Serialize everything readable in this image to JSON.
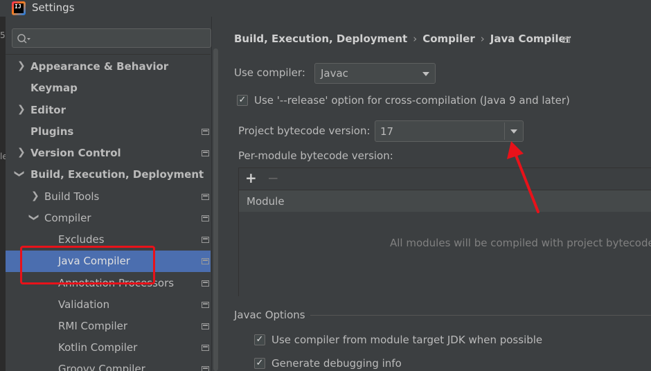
{
  "window": {
    "title": "Settings"
  },
  "gutter": {
    "frag1": "5",
    "frag2": "le"
  },
  "sidebar": {
    "search_placeholder": "",
    "items": [
      {
        "label": "Appearance & Behavior",
        "bold": true
      },
      {
        "label": "Keymap",
        "bold": true
      },
      {
        "label": "Editor",
        "bold": true
      },
      {
        "label": "Plugins",
        "bold": true
      },
      {
        "label": "Version Control",
        "bold": true
      },
      {
        "label": "Build, Execution, Deployment",
        "bold": true
      },
      {
        "label": "Build Tools"
      },
      {
        "label": "Compiler"
      },
      {
        "label": "Excludes"
      },
      {
        "label": "Java Compiler",
        "selected": true
      },
      {
        "label": "Annotation Processors"
      },
      {
        "label": "Validation"
      },
      {
        "label": "RMI Compiler"
      },
      {
        "label": "Kotlin Compiler"
      },
      {
        "label": "Groovy Compiler"
      }
    ]
  },
  "breadcrumb": {
    "part1": "Build, Execution, Deployment",
    "part2": "Compiler",
    "part3": "Java Compiler",
    "separator": "›"
  },
  "compiler": {
    "use_compiler_label": "Use compiler:",
    "use_compiler_value": "Javac",
    "release_option_label": "Use '--release' option for cross-compilation (Java 9 and later)",
    "release_option_checked": true,
    "bytecode_label": "Project bytecode version:",
    "bytecode_value": "17",
    "per_module_label": "Per-module bytecode version:"
  },
  "module_table": {
    "add_label": "+",
    "remove_label": "−",
    "column_header": "Module",
    "empty_text": "All modules will be compiled with project bytecode"
  },
  "javac_options": {
    "group_label": "Javac Options",
    "option1_label": "Use compiler from module target JDK when possible",
    "option1_checked": true,
    "option2_label": "Generate debugging info",
    "option2_checked": true
  },
  "check_glyph": "✓",
  "colors": {
    "selection": "#4b6eaf",
    "annotation_red": "#e8121a",
    "background": "#3c3f41"
  }
}
